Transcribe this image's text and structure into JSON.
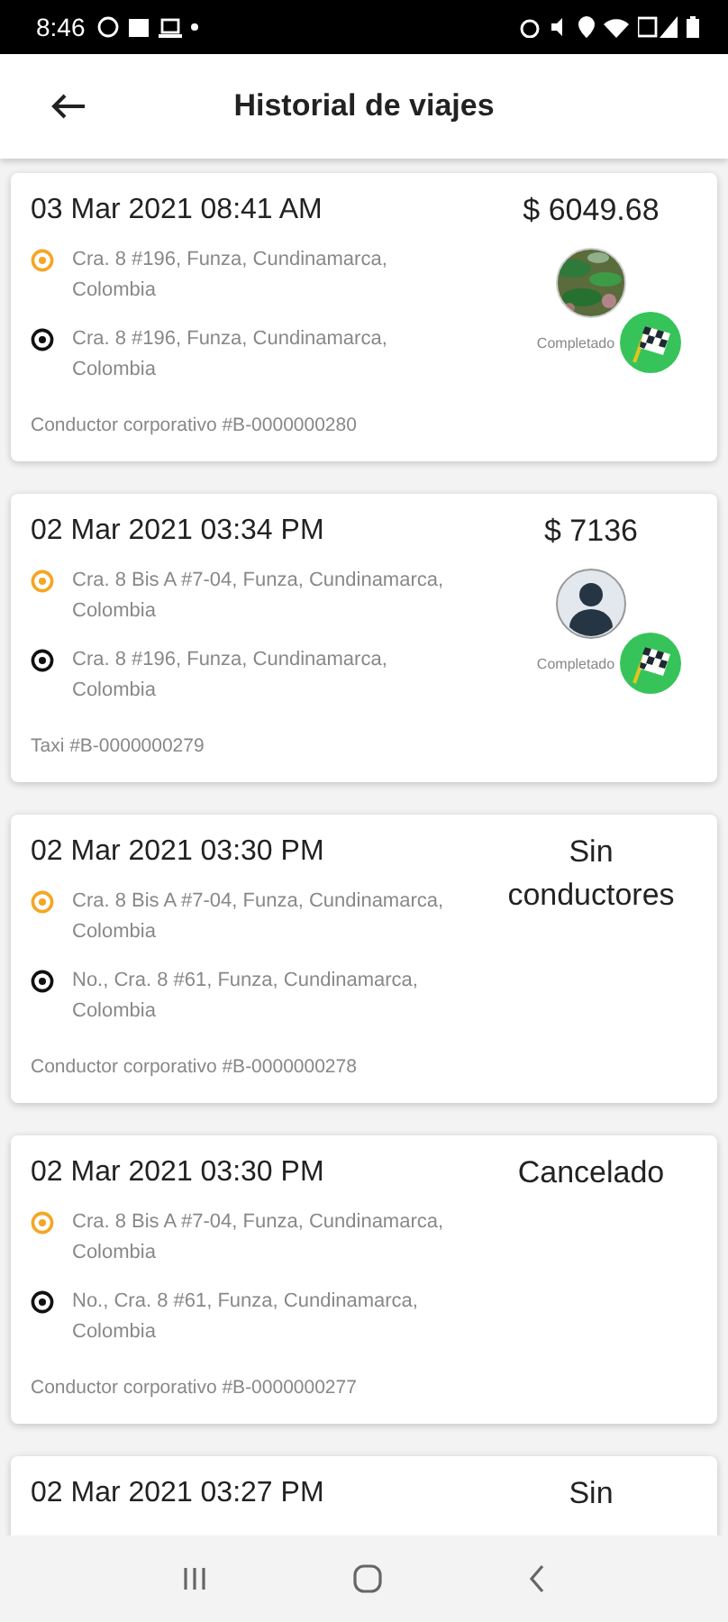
{
  "status_bar": {
    "time": "8:46"
  },
  "header": {
    "title": "Historial de viajes"
  },
  "trips": [
    {
      "date": "03 Mar 2021 08:41 AM",
      "summary": "$ 6049.68",
      "origin": "Cra. 8 #196, Funza, Cundinamarca, Colombia",
      "destination": "Cra. 8 #196, Funza, Cundinamarca, Colombia",
      "status": "Completado",
      "service": "Conductor corporativo #B-0000000280"
    },
    {
      "date": "02 Mar 2021 03:34 PM",
      "summary": "$ 7136",
      "origin": "Cra. 8 Bis A #7-04, Funza, Cundinamarca, Colombia",
      "destination": "Cra. 8 #196, Funza, Cundinamarca, Colombia",
      "driver": {
        "kind": "avatar"
      },
      "status": "Completado",
      "service": "Taxi #B-0000000279"
    },
    {
      "date": "02 Mar 2021 03:30 PM",
      "summary": "Sin conductores",
      "origin": "Cra. 8 Bis A #7-04, Funza, Cundinamarca, Colombia",
      "destination": "No., Cra. 8 #61, Funza, Cundinamarca, Colombia",
      "service": "Conductor corporativo #B-0000000278"
    },
    {
      "date": "02 Mar 2021 03:30 PM",
      "summary": "Cancelado",
      "origin": "Cra. 8 Bis A #7-04, Funza, Cundinamarca, Colombia",
      "destination": "No., Cra. 8 #61, Funza, Cundinamarca, Colombia",
      "service": "Conductor corporativo #B-0000000277"
    },
    {
      "date": "02 Mar 2021 03:27 PM",
      "summary": "Sin"
    }
  ]
}
